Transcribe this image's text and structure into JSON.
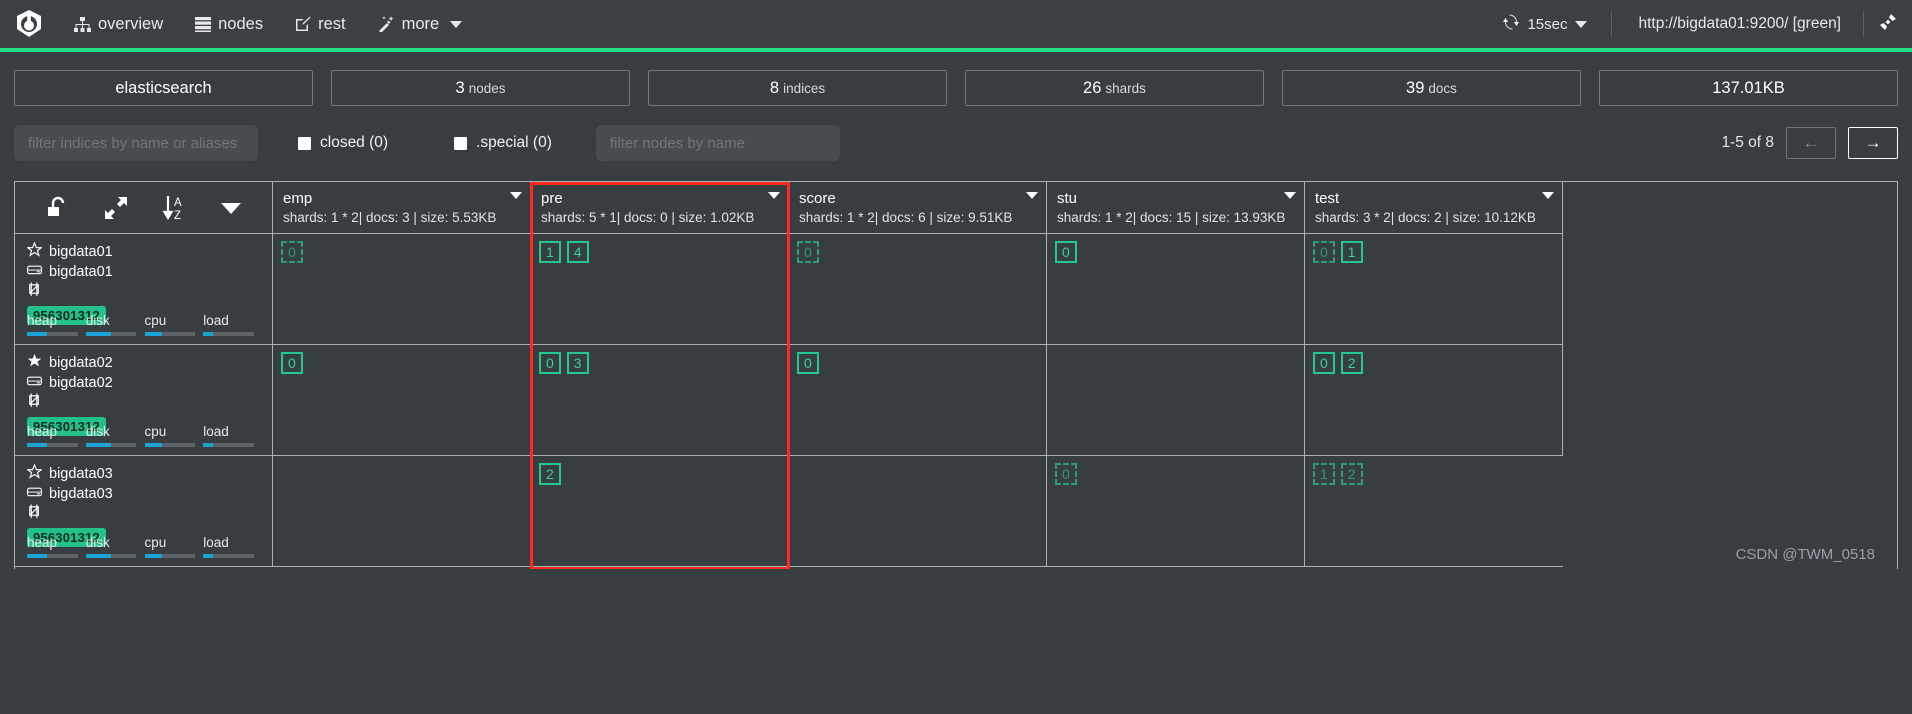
{
  "navbar": {
    "logo_icon": "elasticsearch-head-logo",
    "items": [
      {
        "label": "overview",
        "icon": "sitemap-icon"
      },
      {
        "label": "nodes",
        "icon": "server-list-icon"
      },
      {
        "label": "rest",
        "icon": "edit-square-icon"
      },
      {
        "label": "more",
        "icon": "magic-wand-icon",
        "has_caret": true
      }
    ],
    "refresh": {
      "icon": "refresh-icon",
      "label": "15sec",
      "has_caret": true
    },
    "cluster_url": "http://bigdata01:9200/ [green]",
    "connect_icon": "plug-icon"
  },
  "stats": [
    {
      "value": "elasticsearch",
      "unit": ""
    },
    {
      "value": "3",
      "unit": "nodes"
    },
    {
      "value": "8",
      "unit": "indices"
    },
    {
      "value": "26",
      "unit": "shards"
    },
    {
      "value": "39",
      "unit": "docs"
    },
    {
      "value": "137.01KB",
      "unit": ""
    }
  ],
  "filters": {
    "indices_placeholder": "filter indices by name or aliases",
    "indices_value": "",
    "nodes_placeholder": "filter nodes by name",
    "nodes_value": "",
    "checkboxes": [
      {
        "label": "closed (0)",
        "checked": false
      },
      {
        "label": ".special (0)",
        "checked": false
      }
    ],
    "pager": {
      "range_label": "1-5 of 8",
      "prev_label": "←",
      "next_label": "→"
    }
  },
  "table": {
    "toolbar": {
      "unlock_icon": "open-padlock-icon",
      "expand_icon": "expand-arrows-icon",
      "sort_az_icon": "sort-alpha-down-icon",
      "caret_icon": "caret-down-icon"
    },
    "index_columns": [
      {
        "name": "emp",
        "summary": "shards: 1 * 2| docs: 3 | size: 5.53KB",
        "highlighted": false
      },
      {
        "name": "pre",
        "summary": "shards: 5 * 1| docs: 0 | size: 1.02KB",
        "highlighted": true
      },
      {
        "name": "score",
        "summary": "shards: 1 * 2| docs: 6 | size: 9.51KB",
        "highlighted": false
      },
      {
        "name": "stu",
        "summary": "shards: 1 * 2| docs: 15 | size: 13.93KB",
        "highlighted": false
      },
      {
        "name": "test",
        "summary": "shards: 3 * 2| docs: 2 | size: 10.12KB",
        "highlighted": false
      }
    ],
    "nodes": [
      {
        "star_icon": "star-outline-icon",
        "name": "bigdata01",
        "host_icon": "hdd-icon",
        "host": "bigdata01",
        "settings_icon": "node-settings-icon",
        "badge": "956301312",
        "meters": [
          {
            "label": "heap",
            "pct": 40
          },
          {
            "label": "disk",
            "pct": 50
          },
          {
            "label": "cpu",
            "pct": 34
          },
          {
            "label": "load",
            "pct": 20
          }
        ],
        "shards": [
          [
            {
              "value": "0",
              "type": "replica"
            }
          ],
          [
            {
              "value": "1",
              "type": "primary"
            },
            {
              "value": "4",
              "type": "primary"
            }
          ],
          [
            {
              "value": "0",
              "type": "replica"
            }
          ],
          [
            {
              "value": "0",
              "type": "primary"
            }
          ],
          [
            {
              "value": "0",
              "type": "replica"
            },
            {
              "value": "1",
              "type": "primary"
            }
          ]
        ]
      },
      {
        "star_icon": "star-filled-icon",
        "name": "bigdata02",
        "host_icon": "hdd-icon",
        "host": "bigdata02",
        "settings_icon": "node-settings-icon",
        "badge": "956301312",
        "meters": [
          {
            "label": "heap",
            "pct": 40
          },
          {
            "label": "disk",
            "pct": 50
          },
          {
            "label": "cpu",
            "pct": 34
          },
          {
            "label": "load",
            "pct": 20
          }
        ],
        "shards": [
          [
            {
              "value": "0",
              "type": "primary"
            }
          ],
          [
            {
              "value": "0",
              "type": "primary"
            },
            {
              "value": "3",
              "type": "primary"
            }
          ],
          [
            {
              "value": "0",
              "type": "primary"
            }
          ],
          [],
          [
            {
              "value": "0",
              "type": "primary"
            },
            {
              "value": "2",
              "type": "primary"
            }
          ]
        ]
      },
      {
        "star_icon": "star-outline-icon",
        "name": "bigdata03",
        "host_icon": "hdd-icon",
        "host": "bigdata03",
        "settings_icon": "node-settings-icon",
        "badge": "956301312",
        "meters": [
          {
            "label": "heap",
            "pct": 40
          },
          {
            "label": "disk",
            "pct": 50
          },
          {
            "label": "cpu",
            "pct": 34
          },
          {
            "label": "load",
            "pct": 20
          }
        ],
        "shards": [
          [],
          [
            {
              "value": "2",
              "type": "primary"
            }
          ],
          [],
          [
            {
              "value": "0",
              "type": "replica"
            }
          ],
          [
            {
              "value": "1",
              "type": "replica"
            },
            {
              "value": "2",
              "type": "replica"
            }
          ]
        ]
      }
    ]
  },
  "watermark": "CSDN @TWM_0518",
  "colors": {
    "accent_green": "#22dd88",
    "shard_primary": "#22c98e",
    "shard_replica": "#2a9c76",
    "highlight_red": "#ff2a1f",
    "meter_blue": "#1ba3d6",
    "bg": "#373d41",
    "navbar_bg": "#3a4043"
  }
}
